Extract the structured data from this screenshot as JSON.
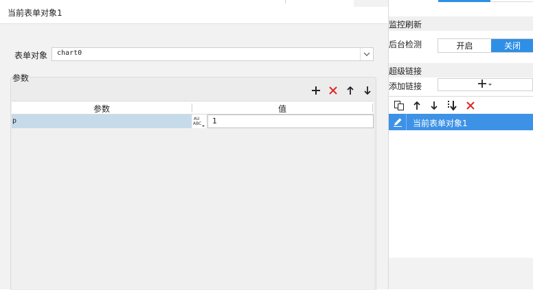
{
  "dialog": {
    "title": "当前表单对象1",
    "form_object_label": "表单对象",
    "form_object_value": "chart0",
    "params_group_label": "参数",
    "toolbar": {
      "add_icon": "plus-icon",
      "delete_icon": "close-icon",
      "up_icon": "arrow-up-icon",
      "down_icon": "arrow-down-icon"
    },
    "table": {
      "columns": [
        "参数",
        "值"
      ],
      "rows": [
        {
          "name": "p",
          "value": "1"
        }
      ]
    }
  },
  "right_panel": {
    "monitor_refresh": {
      "title": "监控刷新",
      "background_check_label": "后台检测",
      "options": [
        "开启",
        "关闭"
      ],
      "selected": "关闭"
    },
    "hyperlink": {
      "title": "超级链接",
      "add_link_label": "添加链接",
      "add_button_icon": "plus-dropdown-icon",
      "toolbar_icons": [
        "copy-icon",
        "arrow-up-icon",
        "arrow-down-icon",
        "move-bottom-icon",
        "close-icon"
      ],
      "items": [
        {
          "label": "当前表单对象1",
          "icon": "pencil-icon",
          "selected": true
        }
      ]
    }
  },
  "colors": {
    "accent": "#2f8fe6",
    "delete": "#e02424",
    "selected_row": "#c6dbea"
  }
}
